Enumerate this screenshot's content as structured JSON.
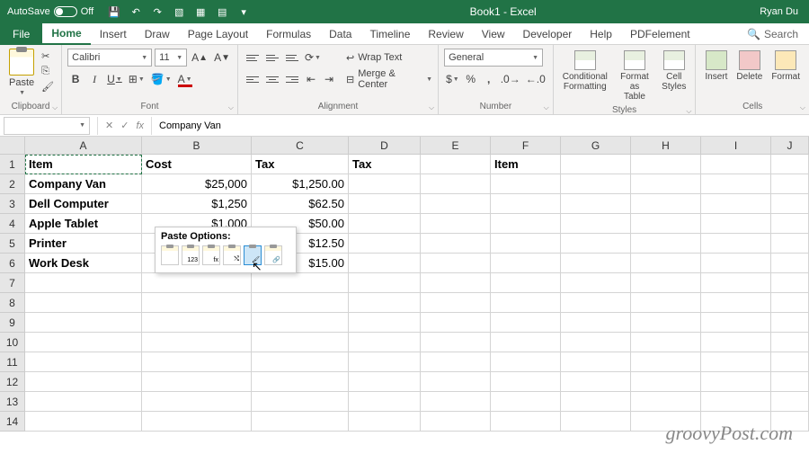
{
  "titlebar": {
    "autosave_label": "AutoSave",
    "autosave_state": "Off",
    "title": "Book1 - Excel",
    "user": "Ryan Du"
  },
  "tabs": {
    "file": "File",
    "home": "Home",
    "insert": "Insert",
    "draw": "Draw",
    "page_layout": "Page Layout",
    "formulas": "Formulas",
    "data": "Data",
    "timeline": "Timeline",
    "review": "Review",
    "view": "View",
    "developer": "Developer",
    "help": "Help",
    "pdfelement": "PDFelement",
    "search": "Search"
  },
  "ribbon": {
    "clipboard": {
      "label": "Clipboard",
      "paste": "Paste"
    },
    "font": {
      "label": "Font",
      "name": "Calibri",
      "size": "11"
    },
    "alignment": {
      "label": "Alignment",
      "wrap": "Wrap Text",
      "merge": "Merge & Center"
    },
    "number": {
      "label": "Number",
      "format": "General"
    },
    "styles": {
      "label": "Styles",
      "conditional": "Conditional\nFormatting",
      "table": "Format as\nTable",
      "cell": "Cell\nStyles"
    },
    "cells": {
      "label": "Cells",
      "insert": "Insert",
      "delete": "Delete",
      "format": "Format"
    }
  },
  "formula_bar": {
    "name_box": "",
    "fx": "fx",
    "value": "Company Van"
  },
  "columns": [
    "A",
    "B",
    "C",
    "D",
    "E",
    "F",
    "G",
    "H",
    "I",
    "J"
  ],
  "rows": [
    "1",
    "2",
    "3",
    "4",
    "5",
    "6",
    "7",
    "8",
    "9",
    "10",
    "11",
    "12",
    "13",
    "14"
  ],
  "data": {
    "r1": {
      "A": "Item",
      "B": "Cost",
      "C": "Tax",
      "D": "Tax",
      "F": "Item"
    },
    "r2": {
      "A": "Company Van",
      "B": "$25,000",
      "C": "$1,250.00"
    },
    "r3": {
      "A": "Dell Computer",
      "B": "$1,250",
      "C": "$62.50"
    },
    "r4": {
      "A": "Apple Tablet",
      "B": "$1,000",
      "C": "$50.00"
    },
    "r5": {
      "A": "Printer",
      "C": "$12.50"
    },
    "r6": {
      "A": "Work Desk",
      "C": "$15.00"
    }
  },
  "paste_options": {
    "title": "Paste Options:"
  },
  "watermark": "groovyPost.com"
}
